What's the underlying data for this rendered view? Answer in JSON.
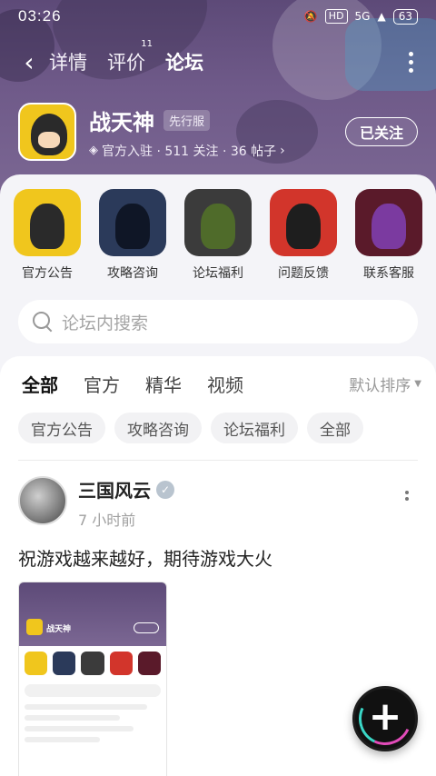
{
  "status_bar": {
    "time": "03:26",
    "network1": "HD",
    "network2": "5G",
    "battery": "63"
  },
  "nav": {
    "tabs": [
      {
        "label": "详情"
      },
      {
        "label": "评价",
        "badge": "11"
      },
      {
        "label": "论坛"
      }
    ],
    "active_tab": "论坛"
  },
  "game": {
    "name": "战天神",
    "server_tag": "先行服",
    "stats": "官方入驻 · 511 关注 · 36 帖子",
    "follow_label": "已关注"
  },
  "quick_links": [
    {
      "label": "官方公告",
      "color": "#f0c61d"
    },
    {
      "label": "攻略咨询",
      "color": "#2b3a5a"
    },
    {
      "label": "论坛福利",
      "color": "#3b3b3b"
    },
    {
      "label": "问题反馈",
      "color": "#d2352b"
    },
    {
      "label": "联系客服",
      "color": "#5a1a2a"
    }
  ],
  "search": {
    "placeholder": "论坛内搜索"
  },
  "filters": {
    "tabs": [
      {
        "label": "全部"
      },
      {
        "label": "官方"
      },
      {
        "label": "精华"
      },
      {
        "label": "视频"
      }
    ],
    "active": "全部",
    "sort_label": "默认排序"
  },
  "chips": [
    {
      "label": "官方公告"
    },
    {
      "label": "攻略咨询"
    },
    {
      "label": "论坛福利"
    },
    {
      "label": "全部"
    }
  ],
  "post": {
    "author": "三国风云",
    "time": "7 小时前",
    "text": "祝游戏越来越好，期待游戏大火"
  },
  "colors": {
    "accent": "#2ad1c2",
    "header_bg": "#6f5a89"
  }
}
